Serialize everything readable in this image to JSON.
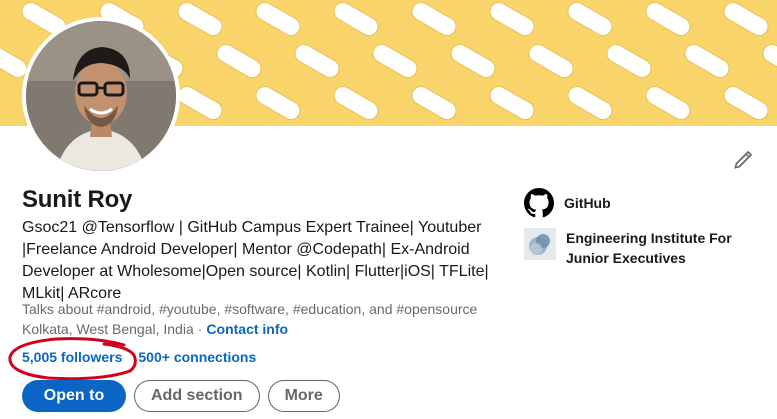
{
  "profile": {
    "name": "Sunit Roy",
    "headline": "Gsoc21 @Tensorflow | GitHub Campus Expert Trainee| Youtuber |Freelance Android Developer| Mentor @Codepath| Ex-Android Developer at Wholesome|Open source| Kotlin| Flutter|iOS| TFLite| MLkit| ARcore",
    "talks_about": "Talks about #android, #youtube, #software, #education, and #opensource",
    "location": "Kolkata, West Bengal, India",
    "separator": "·",
    "contact_info": "Contact info",
    "followers": "5,005 followers",
    "connections": "500+ connections"
  },
  "actions": {
    "open_to": "Open to",
    "add_section": "Add section",
    "more": "More"
  },
  "sidebar": {
    "github": "GitHub",
    "school": "Engineering Institute For Junior Executives"
  },
  "icons": {
    "edit": "pencil-icon",
    "github": "github-logo-icon",
    "school": "school-logo-icon"
  },
  "colors": {
    "accent": "#0a66c2",
    "banner": "#f9d46a",
    "annotation": "#d0021b"
  }
}
